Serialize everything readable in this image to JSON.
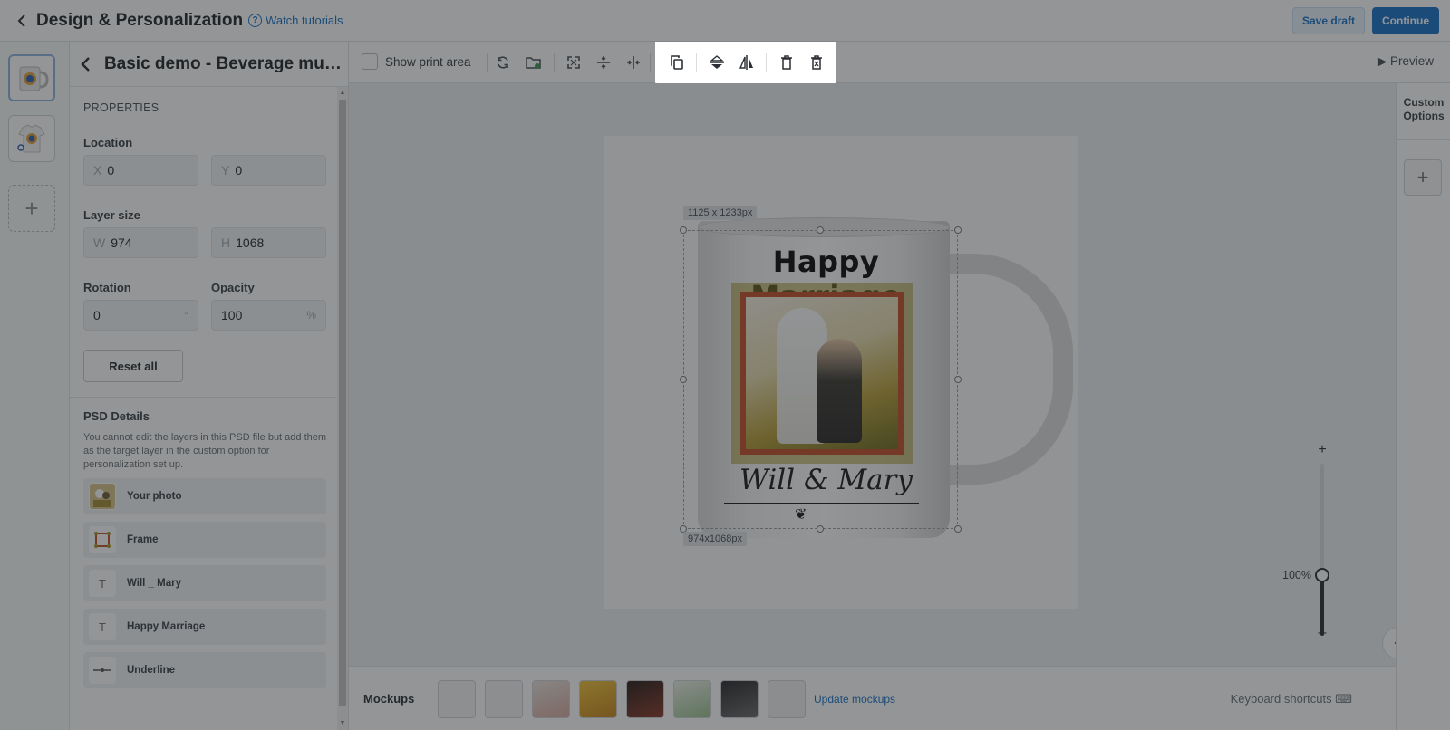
{
  "header": {
    "title": "Design & Personalization",
    "tutorials": "Watch tutorials",
    "save_draft": "Save draft",
    "continue": "Continue"
  },
  "panel": {
    "title": "Basic demo - Beverage mug t...",
    "properties_label": "PROPERTIES",
    "location_label": "Location",
    "x_prefix": "X",
    "x_value": "0",
    "y_prefix": "Y",
    "y_value": "0",
    "size_label": "Layer size",
    "w_prefix": "W",
    "w_value": "974",
    "h_prefix": "H",
    "h_value": "1068",
    "rotation_label": "Rotation",
    "rotation_value": "0",
    "rotation_unit": "°",
    "opacity_label": "Opacity",
    "opacity_value": "100",
    "opacity_unit": "%",
    "reset_label": "Reset all",
    "psd_title": "PSD Details",
    "psd_desc": "You cannot edit the layers in this PSD file but add them as the target layer in the custom option for personalization set up.",
    "layers": [
      {
        "name": "Your photo",
        "icon": "photo-icon"
      },
      {
        "name": "Frame",
        "icon": "frame-icon"
      },
      {
        "name": "Will _ Mary",
        "icon": "text-icon"
      },
      {
        "name": "Happy Marriage",
        "icon": "text-icon"
      },
      {
        "name": "Underline",
        "icon": "line-icon"
      }
    ]
  },
  "toolbar": {
    "show_print_area": "Show print area",
    "preview": "Preview"
  },
  "canvas": {
    "mug_title": "Happy Marriage",
    "mug_names": "Will & Mary",
    "mug_ornament": "❦",
    "size_top": "1125 x 1233px",
    "size_bottom": "974x1068px",
    "zoom": "100%",
    "zoom_plus": "+",
    "zoom_minus": "–"
  },
  "right": {
    "custom_options": "Custom Options",
    "add": "+"
  },
  "mockups": {
    "label": "Mockups",
    "update": "Update mockups",
    "keyboard": "Keyboard shortcuts"
  },
  "thumb_add": "+",
  "colors": {
    "accent": "#1a73c8",
    "frame": "#c5502d"
  }
}
